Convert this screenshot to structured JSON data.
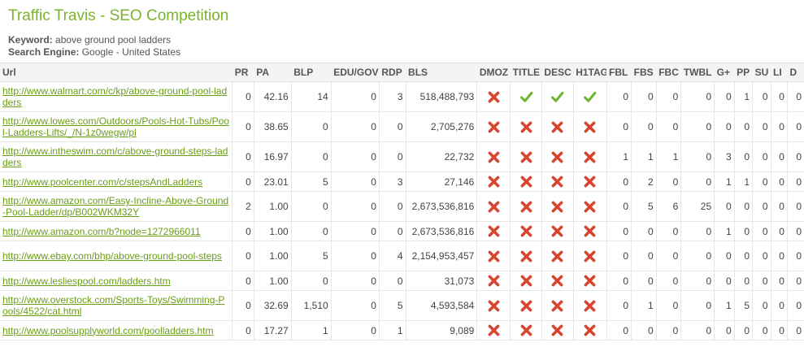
{
  "header": {
    "title": "Traffic Travis - SEO Competition",
    "keyword_label": "Keyword:",
    "keyword_value": "above ground pool ladders",
    "engine_label": "Search Engine:",
    "engine_value": "Google - United States"
  },
  "columns": [
    "Url",
    "PR",
    "PA",
    "BLP",
    "EDU/GOV",
    "RDP",
    "BLS",
    "DMOZ",
    "TITLE",
    "DESC",
    "H1TAG",
    "FBL",
    "FBS",
    "FBC",
    "TWBL",
    "G+",
    "PP",
    "SU",
    "LI",
    "D"
  ],
  "colors": {
    "accent": "#7ab32e",
    "link": "#6a9e14",
    "cross": "#d9442e",
    "check": "#6cb52d"
  },
  "rows": [
    {
      "url": "http://www.walmart.com/c/kp/above-ground-pool-ladders",
      "pr": "0",
      "pa": "42.16",
      "blp": "14",
      "edu": "0",
      "rdp": "3",
      "bls": "518,488,793",
      "icons": [
        "cross",
        "check",
        "check",
        "check"
      ],
      "fbl": "0",
      "fbs": "0",
      "fbc": "0",
      "twbl": "0",
      "gp": "0",
      "pp": "1",
      "su": "0",
      "li": "0",
      "d": "0"
    },
    {
      "url": "http://www.lowes.com/Outdoors/Pools-Hot-Tubs/Pool-Ladders-Lifts/_/N-1z0wegw/pl",
      "pr": "0",
      "pa": "38.65",
      "blp": "0",
      "edu": "0",
      "rdp": "0",
      "bls": "2,705,276",
      "icons": [
        "cross",
        "cross",
        "cross",
        "cross"
      ],
      "fbl": "0",
      "fbs": "0",
      "fbc": "0",
      "twbl": "0",
      "gp": "0",
      "pp": "0",
      "su": "0",
      "li": "0",
      "d": "0"
    },
    {
      "url": "http://www.intheswim.com/c/above-ground-steps-ladders",
      "pr": "0",
      "pa": "16.97",
      "blp": "0",
      "edu": "0",
      "rdp": "0",
      "bls": "22,732",
      "icons": [
        "cross",
        "cross",
        "cross",
        "cross"
      ],
      "fbl": "1",
      "fbs": "1",
      "fbc": "1",
      "twbl": "0",
      "gp": "3",
      "pp": "0",
      "su": "0",
      "li": "0",
      "d": "0"
    },
    {
      "url": "http://www.poolcenter.com/c/stepsAndLadders",
      "pr": "0",
      "pa": "23.01",
      "blp": "5",
      "edu": "0",
      "rdp": "3",
      "bls": "27,146",
      "icons": [
        "cross",
        "cross",
        "cross",
        "cross"
      ],
      "fbl": "0",
      "fbs": "2",
      "fbc": "0",
      "twbl": "0",
      "gp": "1",
      "pp": "1",
      "su": "0",
      "li": "0",
      "d": "0"
    },
    {
      "url": "http://www.amazon.com/Easy-Incline-Above-Ground-Pool-Ladder/dp/B002WKM32Y",
      "pr": "2",
      "pa": "1.00",
      "blp": "0",
      "edu": "0",
      "rdp": "0",
      "bls": "2,673,536,816",
      "icons": [
        "cross",
        "cross",
        "cross",
        "cross"
      ],
      "fbl": "0",
      "fbs": "5",
      "fbc": "6",
      "twbl": "25",
      "gp": "0",
      "pp": "0",
      "su": "0",
      "li": "0",
      "d": "0"
    },
    {
      "url": "http://www.amazon.com/b?node=1272966011",
      "pr": "0",
      "pa": "1.00",
      "blp": "0",
      "edu": "0",
      "rdp": "0",
      "bls": "2,673,536,816",
      "icons": [
        "cross",
        "cross",
        "cross",
        "cross"
      ],
      "fbl": "0",
      "fbs": "0",
      "fbc": "0",
      "twbl": "0",
      "gp": "1",
      "pp": "0",
      "su": "0",
      "li": "0",
      "d": "0"
    },
    {
      "url": "http://www.ebay.com/bhp/above-ground-pool-steps",
      "pr": "0",
      "pa": "1.00",
      "blp": "5",
      "edu": "0",
      "rdp": "4",
      "bls": "2,154,953,457",
      "icons": [
        "cross",
        "cross",
        "cross",
        "cross"
      ],
      "fbl": "0",
      "fbs": "0",
      "fbc": "0",
      "twbl": "0",
      "gp": "0",
      "pp": "0",
      "su": "0",
      "li": "0",
      "d": "0"
    },
    {
      "url": "http://www.lesliespool.com/ladders.htm",
      "pr": "0",
      "pa": "1.00",
      "blp": "0",
      "edu": "0",
      "rdp": "0",
      "bls": "31,073",
      "icons": [
        "cross",
        "cross",
        "cross",
        "cross"
      ],
      "fbl": "0",
      "fbs": "0",
      "fbc": "0",
      "twbl": "0",
      "gp": "0",
      "pp": "0",
      "su": "0",
      "li": "0",
      "d": "0"
    },
    {
      "url": "http://www.overstock.com/Sports-Toys/Swimming-Pools/4522/cat.html",
      "pr": "0",
      "pa": "32.69",
      "blp": "1,510",
      "edu": "0",
      "rdp": "5",
      "bls": "4,593,584",
      "icons": [
        "cross",
        "cross",
        "cross",
        "cross"
      ],
      "fbl": "0",
      "fbs": "1",
      "fbc": "0",
      "twbl": "0",
      "gp": "1",
      "pp": "5",
      "su": "0",
      "li": "0",
      "d": "0"
    },
    {
      "url": "http://www.poolsupplyworld.com/poolladders.htm",
      "pr": "0",
      "pa": "17.27",
      "blp": "1",
      "edu": "0",
      "rdp": "1",
      "bls": "9,089",
      "icons": [
        "cross",
        "cross",
        "cross",
        "cross"
      ],
      "fbl": "0",
      "fbs": "0",
      "fbc": "0",
      "twbl": "0",
      "gp": "0",
      "pp": "0",
      "su": "0",
      "li": "0",
      "d": "0"
    }
  ]
}
